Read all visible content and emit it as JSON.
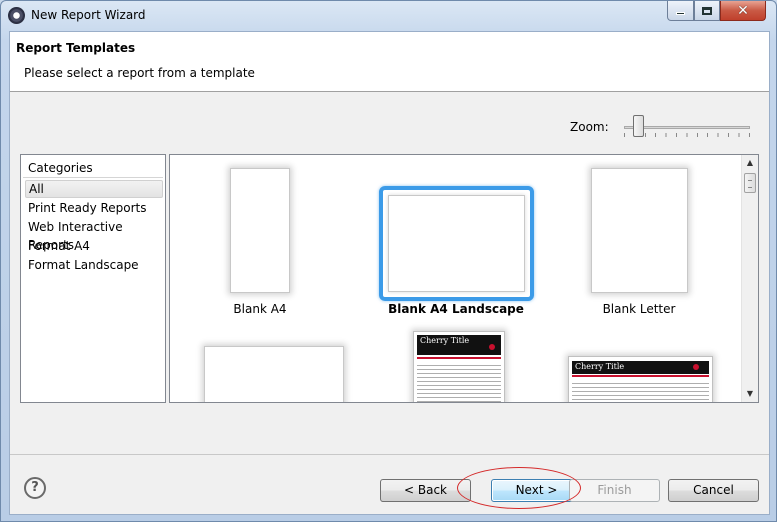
{
  "window": {
    "title": "New Report Wizard"
  },
  "header": {
    "title": "Report Templates",
    "subtitle": "Please select a report from a template"
  },
  "zoom": {
    "label": "Zoom:",
    "level": 0.08
  },
  "categories": {
    "header": "Categories",
    "items": [
      {
        "label": "All",
        "selected": true
      },
      {
        "label": "Print Ready Reports"
      },
      {
        "label": "Web Interactive Reports"
      },
      {
        "label": "Format A4"
      },
      {
        "label": "Format Landscape"
      }
    ]
  },
  "templates": [
    {
      "label": "Blank A4"
    },
    {
      "label": "Blank A4 Landscape",
      "selected": true
    },
    {
      "label": "Blank Letter"
    }
  ],
  "previews": {
    "cherry_title": "Cherry Title"
  },
  "buttons": {
    "back": "< Back",
    "next": "Next >",
    "finish": "Finish",
    "cancel": "Cancel"
  },
  "icons": {
    "app": "report-wizard-icon",
    "help": "help-icon",
    "minimize": "minimize-icon",
    "maximize": "maximize-icon",
    "close": "close-icon"
  },
  "colors": {
    "selection_border": "#3c9be8",
    "annotation_ellipse": "#d42a2a",
    "cherry_red": "#c8102e"
  }
}
